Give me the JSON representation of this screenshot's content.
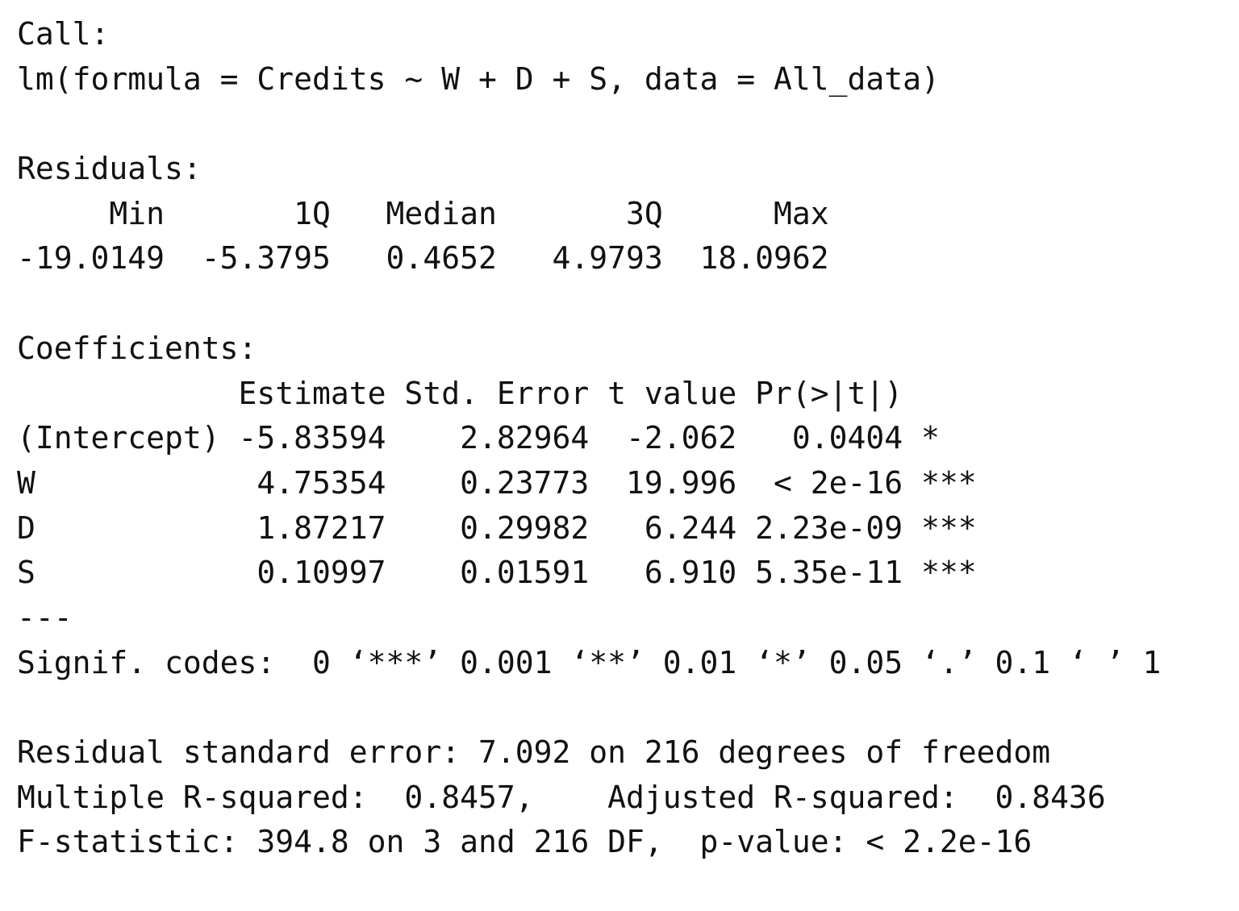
{
  "call": {
    "label": "Call:",
    "formula": "lm(formula = Credits ~ W + D + S, data = All_data)"
  },
  "residuals": {
    "label": "Residuals:",
    "header": "     Min       1Q   Median       3Q      Max ",
    "values": "-19.0149  -5.3795   0.4652   4.9793  18.0962 "
  },
  "coefficients": {
    "label": "Coefficients:",
    "header": "            Estimate Std. Error t value Pr(>|t|)    ",
    "rows": [
      {
        "name": "(Intercept)",
        "line": "(Intercept) -5.83594    2.82964  -2.062   0.0404 *  "
      },
      {
        "name": "W",
        "line": "W            4.75354    0.23773  19.996  < 2e-16 ***"
      },
      {
        "name": "D",
        "line": "D            1.87217    0.29982   6.244 2.23e-09 ***"
      },
      {
        "name": "S",
        "line": "S            0.10997    0.01591   6.910 5.35e-11 ***"
      }
    ],
    "separator": "---",
    "signif_codes": "Signif. codes:  0 ‘***’ 0.001 ‘**’ 0.01 ‘*’ 0.05 ‘.’ 0.1 ‘ ’ 1"
  },
  "summary": {
    "residual_se": "Residual standard error: 7.092 on 216 degrees of freedom",
    "r_squared": "Multiple R-squared:  0.8457,\tAdjusted R-squared:  0.8436 ",
    "f_statistic": "F-statistic: 394.8 on 3 and 216 DF,  p-value: < 2.2e-16"
  }
}
